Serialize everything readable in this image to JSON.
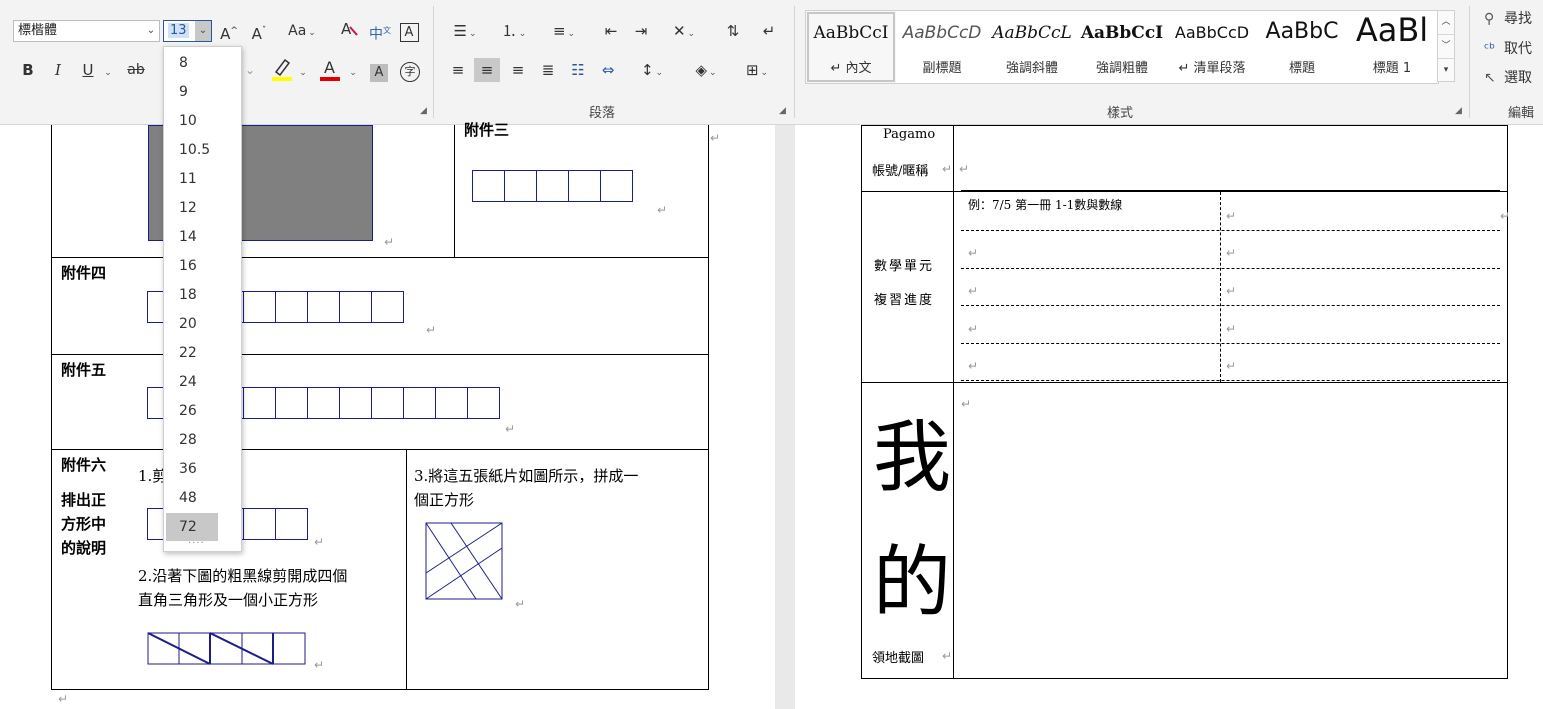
{
  "ribbon": {
    "font": {
      "font_name": "標楷體",
      "font_size": "13",
      "grow_label": "A^",
      "shrink_label": "Aˇ",
      "case_label": "Aa",
      "bold": "B",
      "italic": "I",
      "underline": "U",
      "strike": "ab"
    },
    "paragraph": {
      "label": "段落"
    },
    "styles": {
      "label": "樣式",
      "items": [
        {
          "preview": "AaBbCcI",
          "name": "↵ 內文"
        },
        {
          "preview": "AaBbCcD",
          "name": "副標題"
        },
        {
          "preview": "AaBbCcL",
          "name": "強調斜體"
        },
        {
          "preview": "AaBbCcI",
          "name": "強調粗體"
        },
        {
          "preview": "AaBbCcD",
          "name": "↵ 清單段落"
        },
        {
          "preview": "AaBbC",
          "name": "標題"
        },
        {
          "preview": "AaBl",
          "name": "標題 1"
        }
      ]
    },
    "editing": {
      "label": "編輯",
      "find": "尋找",
      "replace": "取代",
      "select": "選取"
    }
  },
  "font_size_menu": {
    "options": [
      "8",
      "9",
      "10",
      "10.5",
      "11",
      "12",
      "14",
      "16",
      "18",
      "20",
      "22",
      "24",
      "26",
      "28",
      "36",
      "48",
      "72"
    ],
    "highlighted": "72",
    "more": "...."
  },
  "left_page": {
    "attach3": "附件三",
    "attach4": "附件四",
    "attach5": "附件五",
    "attach6": "附件六",
    "attach6_note_1": "排出正",
    "attach6_note_2": "方形中",
    "attach6_note_3": "的說明",
    "step1": "1.剪下六個正",
    "step2_line1": "2.沿著下圖的粗黑線剪開成四個",
    "step2_line2": "直角三角形及一個小正方形",
    "step3_line1": "3.將這五張紙片如圖所示，拼成一",
    "step3_line2": "個正方形"
  },
  "right_page": {
    "account_line1": "Pagamo",
    "account_line2": "帳號/暱稱",
    "unit_line1": "數學單元",
    "unit_line2": "複習進度",
    "example": "例：7/5 第一冊 1-1數與數線",
    "big1": "我",
    "big2": "的",
    "territory": "領地截圖"
  },
  "colors": {
    "accent": "#2b579a",
    "highlight_bar": "#ffff00",
    "font_color_bar": "#e00000",
    "grid_blue": "#1d1d8a"
  }
}
